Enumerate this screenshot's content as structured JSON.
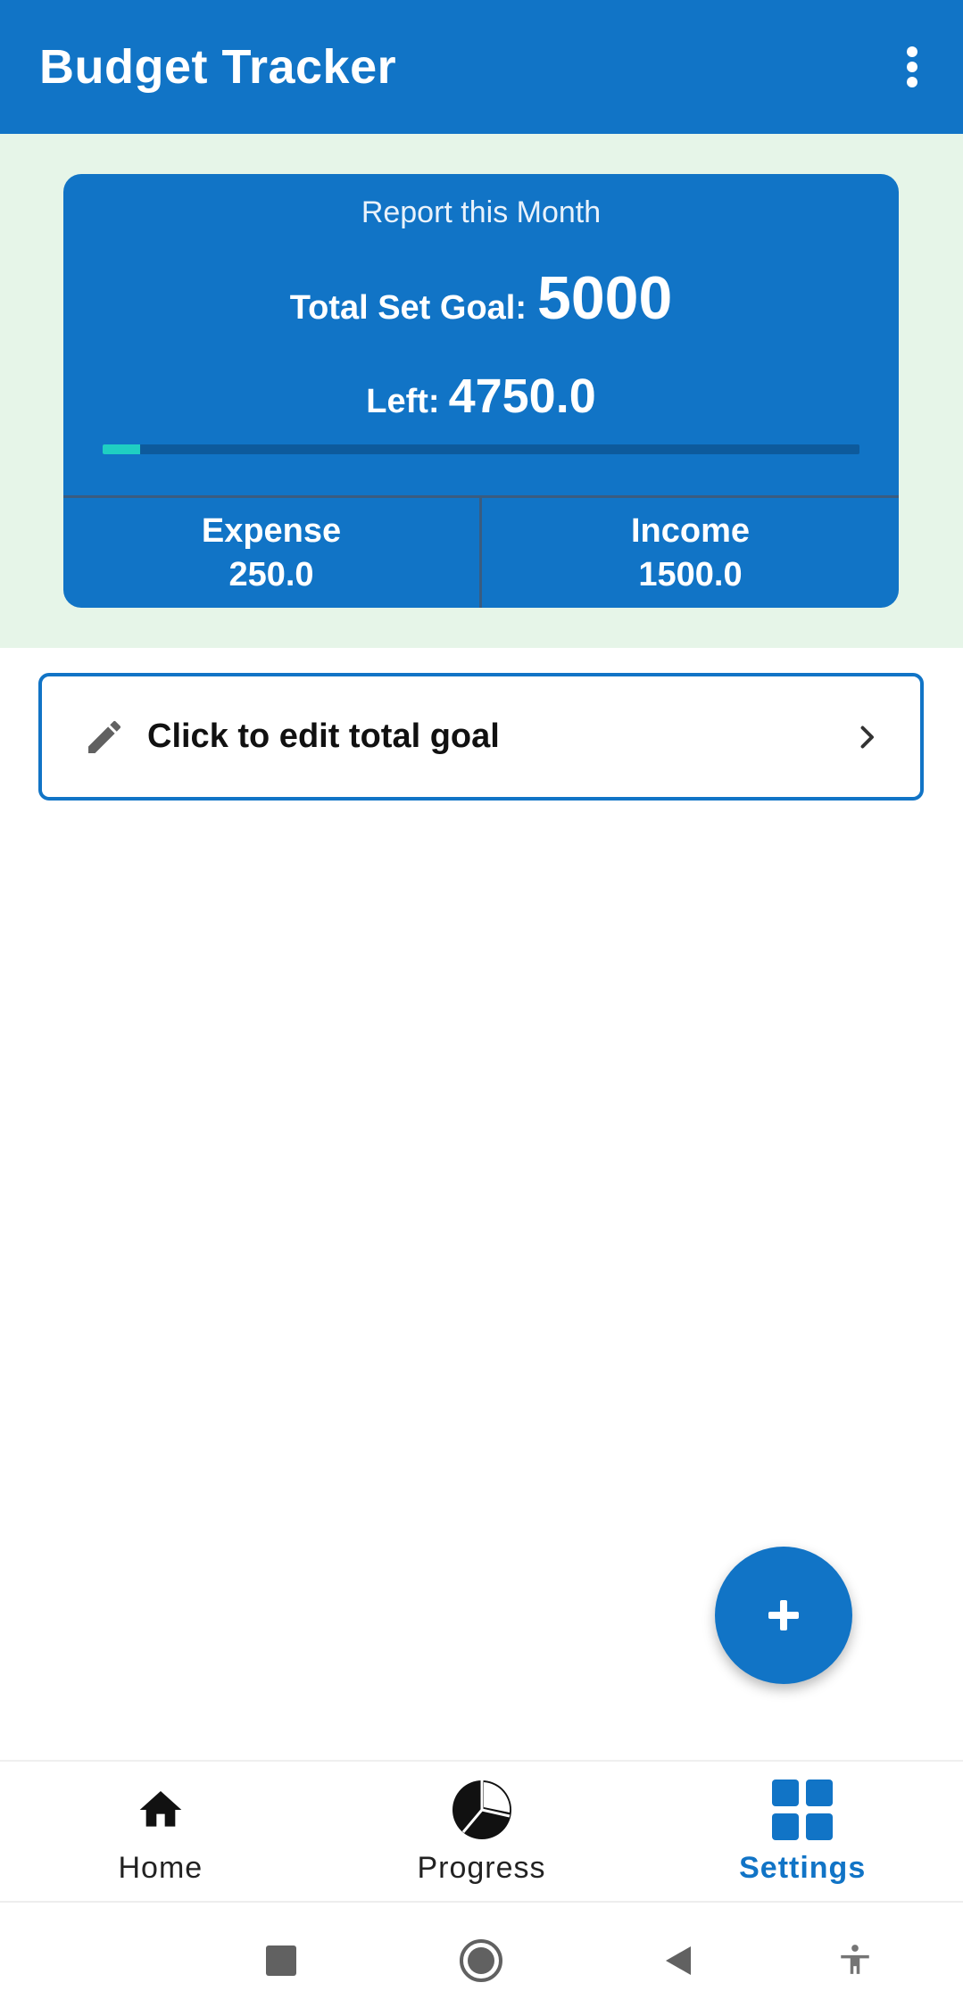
{
  "appbar": {
    "title": "Budget Tracker",
    "more_icon": "more-vert-icon"
  },
  "report": {
    "title": "Report this Month",
    "goal_label": "Total Set Goal:",
    "goal_value": "5000",
    "left_label": "Left:",
    "left_value": "4750.0",
    "progress_fraction": 0.05,
    "expense_label": "Expense",
    "expense_value": "250.0",
    "income_label": "Income",
    "income_value": "1500.0"
  },
  "edit_goal": {
    "label": "Click to edit total goal",
    "icon": "pencil-icon",
    "chevron_icon": "chevron-right-icon"
  },
  "fab": {
    "icon": "plus-icon"
  },
  "bottom_nav": {
    "items": [
      {
        "label": "Home",
        "icon": "home-icon",
        "active": false
      },
      {
        "label": "Progress",
        "icon": "pie-chart-icon",
        "active": false
      },
      {
        "label": "Settings",
        "icon": "grid-icon",
        "active": true
      }
    ]
  },
  "colors": {
    "primary": "#1174c6",
    "band_bg": "#e6f5e8",
    "progress_fill": "#1fcfc2",
    "progress_track": "#0d5a9c"
  }
}
